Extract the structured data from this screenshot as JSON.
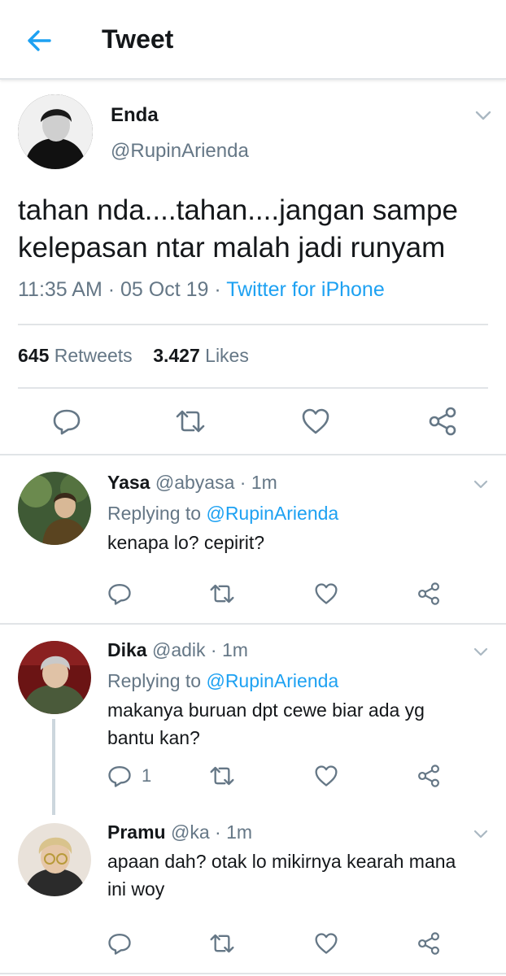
{
  "header": {
    "title": "Tweet",
    "back_icon": "arrow-left-icon",
    "accent": "#1da1f2"
  },
  "tweet": {
    "name": "Enda",
    "handle": "@RupinArienda",
    "text": "tahan nda....tahan....jangan sampe kelepasan ntar malah jadi runyam",
    "time": "11:35 AM",
    "date": "05 Oct 19",
    "dot1": "·",
    "dot2": "·",
    "source": "Twitter for iPhone",
    "retweets_count": "645",
    "retweets_label": "Retweets",
    "likes_count": "3.427",
    "likes_label": "Likes"
  },
  "replies": [
    {
      "name": "Yasa",
      "handle": "@abyasa",
      "dot": "·",
      "time": "1m",
      "replying_prefix": "Replying to",
      "replying_to": "@RupinArienda",
      "text": "kenapa lo? cepirit?",
      "reply_count": ""
    },
    {
      "name": "Dika",
      "handle": "@adik",
      "dot": "·",
      "time": "1m",
      "replying_prefix": "Replying to",
      "replying_to": "@RupinArienda",
      "text": "makanya buruan dpt cewe biar ada yg bantu kan?",
      "reply_count": "1"
    },
    {
      "name": "Pramu",
      "handle": "@ka",
      "dot": "·",
      "time": "1m",
      "text": "apaan dah? otak lo mikirnya kearah mana ini woy",
      "reply_count": ""
    }
  ]
}
